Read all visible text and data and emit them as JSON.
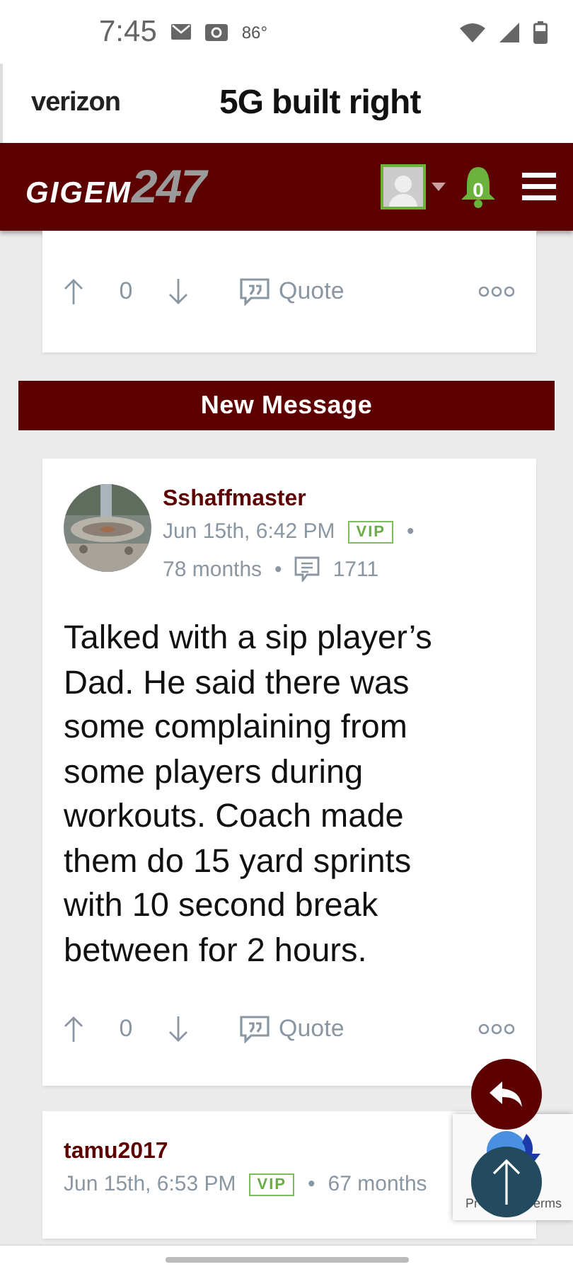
{
  "status_bar": {
    "time": "7:45",
    "temperature": "86°"
  },
  "ad": {
    "brand": "verizon",
    "headline_mark": "5G",
    "headline": "built right"
  },
  "header": {
    "logo_text": "GIGEM",
    "logo_number": "247",
    "notification_count": "0"
  },
  "previous_post": {
    "vote_count": "0",
    "quote_label": "Quote"
  },
  "new_message_bar": "New Message",
  "posts": [
    {
      "author": "Sshaffmaster",
      "date": "Jun 15th, 6:42 PM",
      "badge": "VIP",
      "tenure": "78 months",
      "separators": [
        "•",
        "•"
      ],
      "post_count": "1711",
      "body": "Talked with a sip player’s Dad. He said there was some complaining from some players during workouts. Coach made them do 15 yard sprints with 10 second break between for 2 hours.",
      "vote_count": "0",
      "quote_label": "Quote"
    },
    {
      "author": "tamu2017",
      "date": "Jun 15th, 6:53 PM",
      "badge": "VIP",
      "tenure": "67 months",
      "separators": [
        "•"
      ]
    }
  ],
  "recaptcha": {
    "left_text": "Pr",
    "right_text": "erms"
  }
}
